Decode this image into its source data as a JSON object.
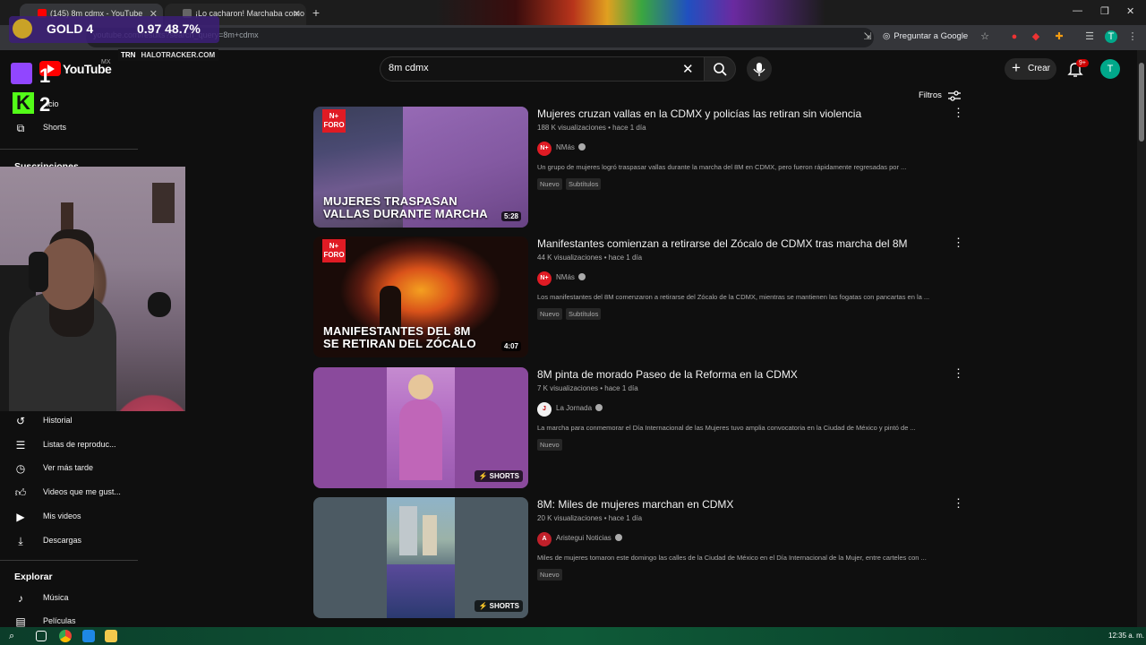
{
  "browser": {
    "tabs": [
      {
        "label": "(145) 8m cdmx - YouTube"
      },
      {
        "label": "¡Lo cacharon! Marchaba como"
      }
    ],
    "url": "youtube.com/results?search_query=8m+cdmx",
    "ask_google": "Preguntar a Google"
  },
  "overlay": {
    "rank": "GOLD 4",
    "kd": "0.97 48.7%",
    "trn_brand": "TRN",
    "trn_site": "HALOTRACKER.COM",
    "slot1": "1",
    "slot2": "2"
  },
  "youtube": {
    "logo_text": "YouTube",
    "country": "MX",
    "search_value": "8m cdmx",
    "create_label": "Crear",
    "notif_count": "9+",
    "avatar_letter": "T",
    "filters_label": "Filtros"
  },
  "sidebar": {
    "partial_home": "icio",
    "shorts": "Shorts",
    "subscriptions": "Suscripciones",
    "you_items": [
      {
        "label": "Historial",
        "icon": "history-icon"
      },
      {
        "label": "Listas de reproduc...",
        "icon": "playlist-icon"
      },
      {
        "label": "Ver más tarde",
        "icon": "watch-later-icon"
      },
      {
        "label": "Videos que me gust...",
        "icon": "thumbs-up-icon"
      },
      {
        "label": "Mis videos",
        "icon": "my-videos-icon"
      },
      {
        "label": "Descargas",
        "icon": "download-icon"
      }
    ],
    "explore_heading": "Explorar",
    "explore_items": [
      {
        "label": "Música",
        "icon": "music-icon"
      },
      {
        "label": "Películas",
        "icon": "movies-icon"
      }
    ]
  },
  "results": [
    {
      "title": "Mujeres cruzan vallas en la CDMX y policías las retiran sin violencia",
      "meta": "188 K visualizaciones • hace 1 día",
      "channel": "NMás",
      "description": "Un grupo de mujeres logró traspasar vallas durante la marcha del 8M en CDMX, pero fueron rápidamente regresadas por ...",
      "tags": [
        "Nuevo",
        "Subtítulos"
      ],
      "thumb_text": [
        "MUJERES TRASPASAN",
        "VALLAS DURANTE MARCHA"
      ],
      "thumb_logo": [
        "N+",
        "FORO"
      ],
      "duration": "5:28"
    },
    {
      "title": "Manifestantes comienzan a retirarse del Zócalo de CDMX tras marcha del 8M",
      "meta": "44 K visualizaciones • hace 1 día",
      "channel": "NMás",
      "description": "Los manifestantes del 8M comenzaron a retirarse del Zócalo de la CDMX, mientras se mantienen las fogatas con pancartas en la ...",
      "tags": [
        "Nuevo",
        "Subtítulos"
      ],
      "thumb_text": [
        "MANIFESTANTES DEL 8M",
        "SE RETIRAN DEL ZÓCALO"
      ],
      "thumb_logo": [
        "N+",
        "FORO"
      ],
      "duration": "4:07"
    },
    {
      "title": "8M pinta de morado Paseo de la Reforma en la CDMX",
      "meta": "7 K visualizaciones • hace 1 día",
      "channel": "La Jornada",
      "description": "La marcha para conmemorar el Día Internacional de las Mujeres tuvo amplia convocatoria en la Ciudad de México y pintó de ...",
      "tags": [
        "Nuevo"
      ],
      "shorts_label": "SHORTS"
    },
    {
      "title": "8M: Miles de mujeres marchan en CDMX",
      "meta": "20 K visualizaciones • hace 1 día",
      "channel": "Aristegui Noticias",
      "description": "Miles de mujeres tomaron este domingo las calles de la Ciudad de México en el Día Internacional de la Mujer, entre carteles con ...",
      "tags": [
        "Nuevo"
      ],
      "shorts_label": "SHORTS"
    }
  ],
  "taskbar": {
    "clock": "12:35 a. m."
  },
  "colors": {
    "background": "#0f0f0f",
    "youtube_red": "#ff0000",
    "nmas_red": "#e01b24",
    "avatar": "#00a88a",
    "twitch": "#9146ff",
    "kick": "#53fc18"
  }
}
